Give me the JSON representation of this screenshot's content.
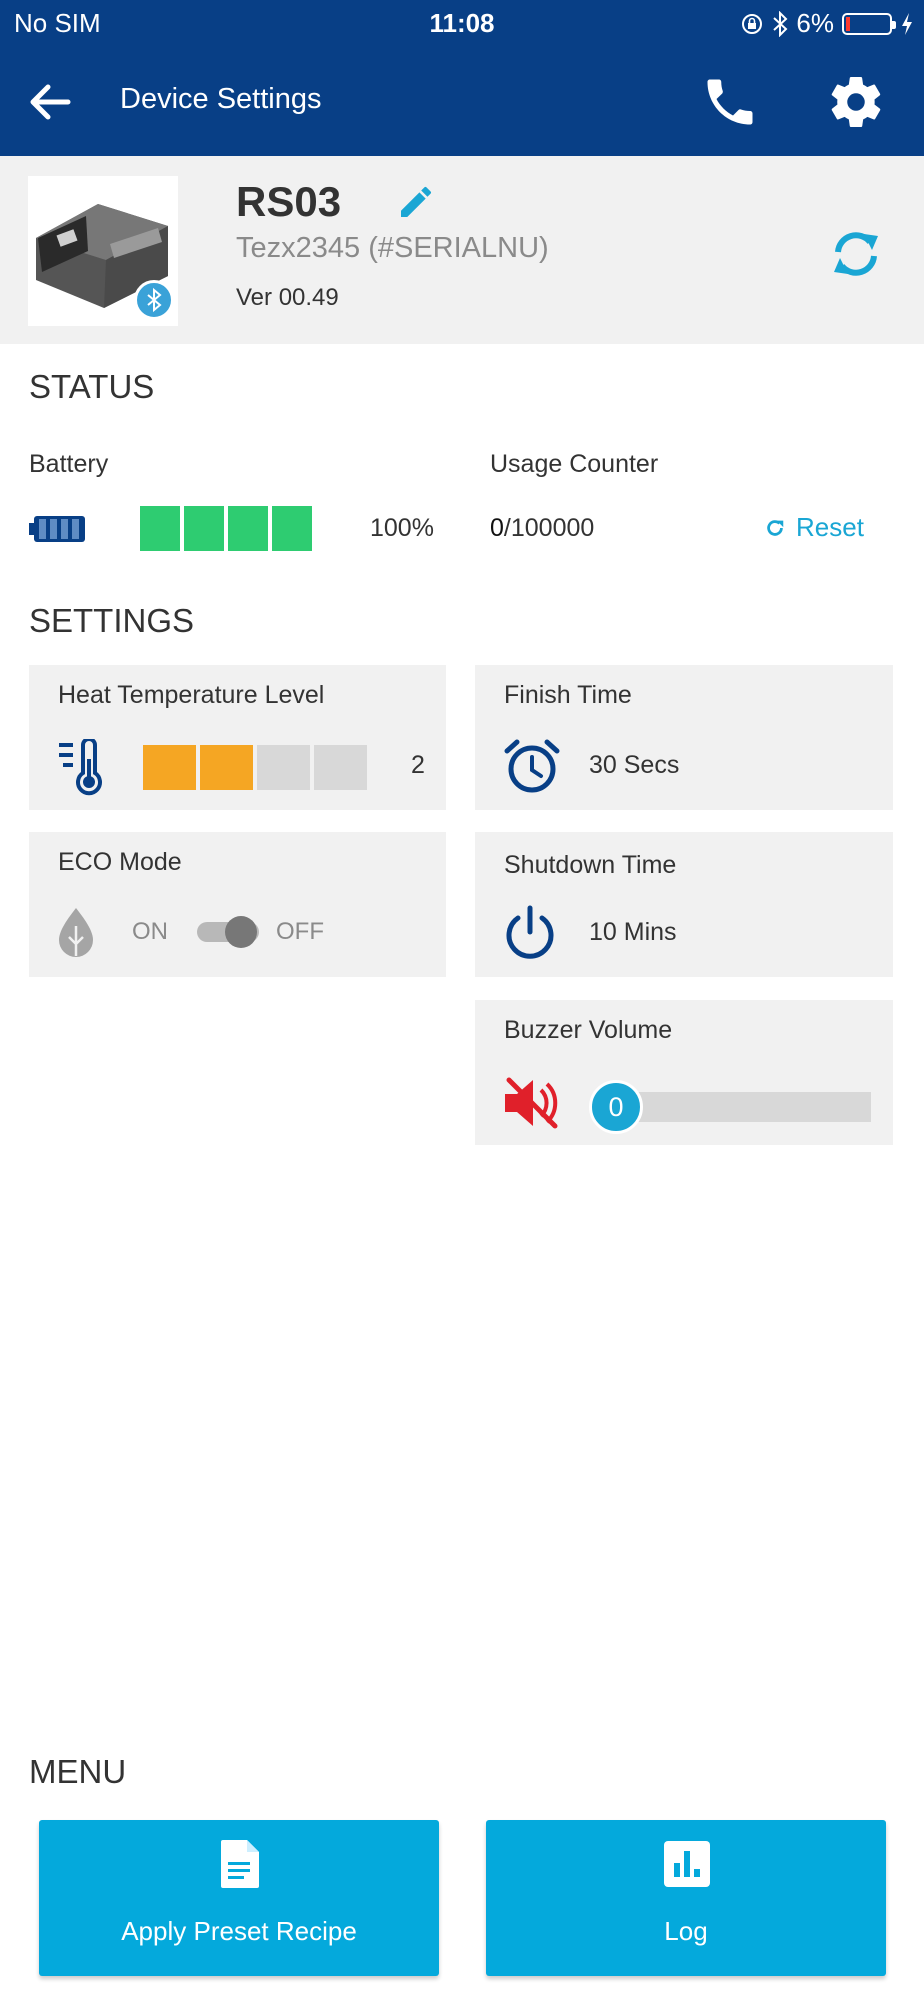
{
  "status_bar": {
    "carrier": "No SIM",
    "time": "11:08",
    "battery_pct": "6%",
    "icons": [
      "orientation-lock-icon",
      "bluetooth-icon",
      "battery-icon",
      "charging-icon"
    ]
  },
  "app_bar": {
    "title": "Device Settings",
    "icons": [
      "back-arrow-icon",
      "phone-icon",
      "gear-icon"
    ]
  },
  "device": {
    "name": "RS03",
    "serial": "Tezx2345 (#SERIALNU)",
    "version": "Ver 00.49",
    "icons": [
      "bluetooth-badge-icon",
      "pencil-icon",
      "sync-icon"
    ]
  },
  "status": {
    "title": "STATUS",
    "battery_label": "Battery",
    "battery_level": 1.0,
    "battery_bars_total": 4,
    "battery_value": "100%",
    "usage_label": "Usage Counter",
    "usage_current": "0",
    "usage_max": "/100000",
    "reset_label": "Reset"
  },
  "settings": {
    "title": "SETTINGS",
    "heat": {
      "label": "Heat Temperature Level",
      "level": 2,
      "max_level": 4,
      "value": "2"
    },
    "finish": {
      "label": "Finish Time",
      "value": "30 Secs"
    },
    "eco": {
      "label": "ECO Mode",
      "on_label": "ON",
      "off_label": "OFF",
      "state": "off"
    },
    "shutdown": {
      "label": "Shutdown Time",
      "value": "10 Mins"
    },
    "buzzer": {
      "label": "Buzzer Volume",
      "value": "0"
    }
  },
  "menu": {
    "title": "MENU",
    "items": [
      {
        "label": "Apply Preset Recipe",
        "icon": "document-icon"
      },
      {
        "label": "Log",
        "icon": "bar-chart-icon"
      }
    ]
  },
  "colors": {
    "header": "#083f86",
    "accent": "#1aa6d4",
    "battery_green": "#2ecc71",
    "heat_orange": "#f5a623",
    "muted_red": "#e0202a",
    "card_bg": "#f1f1f1"
  }
}
